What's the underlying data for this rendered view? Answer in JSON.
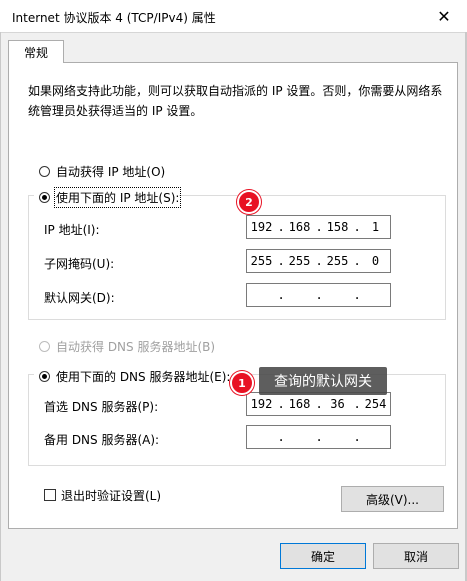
{
  "window": {
    "title": "Internet 协议版本 4 (TCP/IPv4) 属性",
    "close_glyph": "✕"
  },
  "tab": {
    "label": "常规"
  },
  "description": "如果网络支持此功能，则可以获取自动指派的 IP 设置。否则，你需要从网络系统管理员处获得适当的 IP 设置。",
  "ip_section": {
    "auto_label": "自动获得 IP 地址(O)",
    "manual_label": "使用下面的 IP 地址(S):",
    "ip_label": "IP 地址(I):",
    "mask_label": "子网掩码(U):",
    "gateway_label": "默认网关(D):",
    "ip": [
      "192",
      "168",
      "158",
      "1"
    ],
    "mask": [
      "255",
      "255",
      "255",
      "0"
    ],
    "gateway": [
      "",
      "",
      "",
      ""
    ]
  },
  "dns_section": {
    "auto_label": "自动获得 DNS 服务器地址(B)",
    "manual_label": "使用下面的 DNS 服务器地址(E):",
    "preferred_label": "首选 DNS 服务器(P):",
    "alternate_label": "备用 DNS 服务器(A):",
    "preferred": [
      "192",
      "168",
      "36",
      "254"
    ],
    "alternate": [
      "",
      "",
      "",
      ""
    ]
  },
  "validate_label": "退出时验证设置(L)",
  "advanced_button": "高级(V)...",
  "ok_button": "确定",
  "cancel_button": "取消",
  "annotations": {
    "badge1": "1",
    "badge2": "2",
    "tooltip": "查询的默认网关"
  },
  "colors": {
    "accent": "#0078d7",
    "badge": "#e81123"
  }
}
